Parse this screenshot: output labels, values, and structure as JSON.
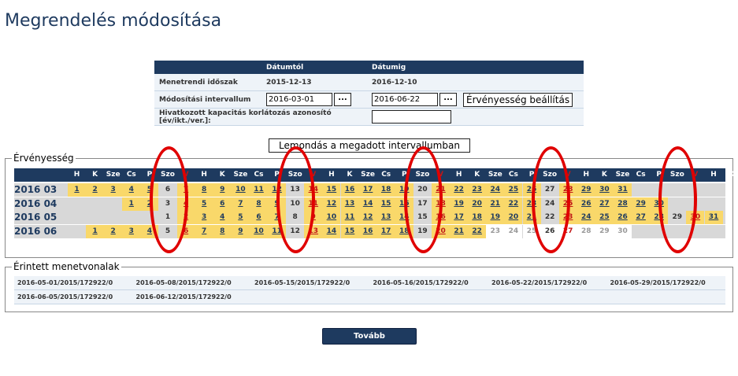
{
  "title": "Megrendelés módosítása",
  "form": {
    "headers": [
      "",
      "Dátumtól",
      "Dátumig",
      ""
    ],
    "menetrendi_label": "Menetrendi időszak",
    "menetrendi_from": "2015-12-13",
    "menetrendi_to": "2016-12-10",
    "modositasi_label": "Módosítási intervallum",
    "modositasi_from": "2016-03-01",
    "modositasi_to": "2016-06-22",
    "dots": "...",
    "ervenyesseg_btn": "Érvényesség beállítás",
    "hivatkozott_label": "Hivatkozott kapacitás korlátozás azonosító [év/ikt./ver.]:",
    "hivatkozott_value": ""
  },
  "lemondas_btn": "Lemondás a megadott intervallumban",
  "ervenyesseg_legend": "Érvényesség",
  "calendar": {
    "weekday_headers": [
      "H",
      "K",
      "Sze",
      "Cs",
      "P",
      "Szo",
      "V",
      "H",
      "K",
      "Sze",
      "Cs",
      "P",
      "Szo",
      "V",
      "H",
      "K",
      "Sze",
      "Cs",
      "P",
      "Szo",
      "V",
      "H",
      "K",
      "Sze",
      "Cs",
      "P",
      "Szo",
      "V",
      "H",
      "K",
      "Sze",
      "Cs",
      "P",
      "Szo",
      "V",
      "H",
      "K"
    ],
    "rows": [
      {
        "label": "2016 03",
        "start": 1,
        "days": 31,
        "active_from": 1,
        "active_to": 31
      },
      {
        "label": "2016 04",
        "start": 4,
        "days": 30,
        "active_from": 1,
        "active_to": 30
      },
      {
        "label": "2016 05",
        "start": 6,
        "days": 31,
        "active_from": 1,
        "active_to": 31
      },
      {
        "label": "2016 06",
        "start": 2,
        "days": 30,
        "active_from": 1,
        "active_to": 22
      }
    ],
    "colors": {
      "header_bg": "#1e3a5f",
      "active": "#f9d86a",
      "weekend": "#d8d8d8",
      "red": "#c01818",
      "circle": "#e00000"
    }
  },
  "routes_legend": "Érintett menetvonalak",
  "routes": [
    [
      "2016-05-01/2015/172922/0",
      "2016-05-08/2015/172922/0",
      "2016-05-15/2015/172922/0",
      "2016-05-16/2015/172922/0",
      "2016-05-22/2015/172922/0",
      "2016-05-29/2015/172922/0"
    ],
    [
      "2016-06-05/2015/172922/0",
      "2016-06-12/2015/172922/0",
      "",
      "",
      "",
      ""
    ]
  ],
  "tovabb_btn": "Tovább"
}
